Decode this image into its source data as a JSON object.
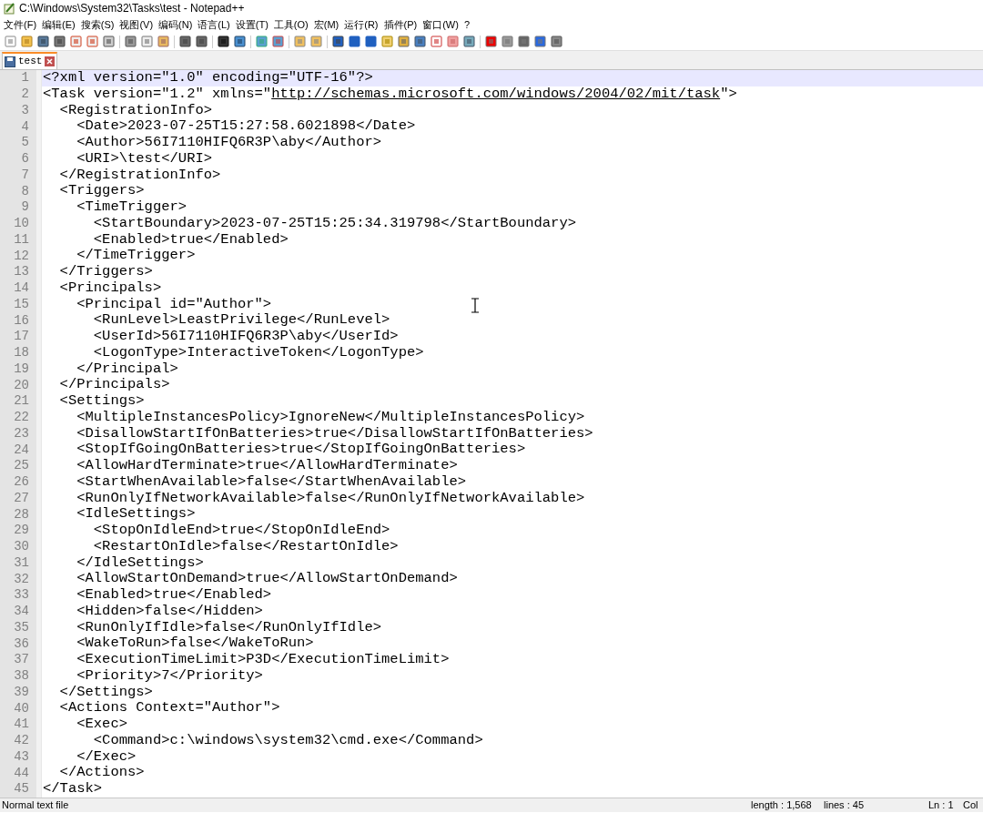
{
  "window": {
    "title": "C:\\Windows\\System32\\Tasks\\test - Notepad++"
  },
  "menu": [
    "文件(F)",
    "编辑(E)",
    "搜索(S)",
    "视图(V)",
    "编码(N)",
    "语言(L)",
    "设置(T)",
    "工具(O)",
    "宏(M)",
    "运行(R)",
    "插件(P)",
    "窗口(W)",
    "?"
  ],
  "tabs": [
    {
      "label": "test",
      "selected": true
    }
  ],
  "editor": {
    "lines": [
      {
        "number": "1",
        "current": true,
        "text": "<?xml version=\"1.0\" encoding=\"UTF-16\"?>"
      },
      {
        "number": "2",
        "current": false,
        "parts": [
          {
            "text": "<Task version=\"1.2\" xmlns=\""
          },
          {
            "text": "http://schemas.microsoft.com/windows/2004/02/mit/task",
            "kind": "link"
          },
          {
            "text": "\">"
          }
        ]
      },
      {
        "number": "3",
        "current": false,
        "text": "  <RegistrationInfo>"
      },
      {
        "number": "4",
        "current": false,
        "text": "    <Date>2023-07-25T15:27:58.6021898</Date>"
      },
      {
        "number": "5",
        "current": false,
        "text": "    <Author>56I7110HIFQ6R3P\\aby</Author>"
      },
      {
        "number": "6",
        "current": false,
        "text": "    <URI>\\test</URI>"
      },
      {
        "number": "7",
        "current": false,
        "text": "  </RegistrationInfo>"
      },
      {
        "number": "8",
        "current": false,
        "text": "  <Triggers>"
      },
      {
        "number": "9",
        "current": false,
        "text": "    <TimeTrigger>"
      },
      {
        "number": "10",
        "current": false,
        "text": "      <StartBoundary>2023-07-25T15:25:34.319798</StartBoundary>"
      },
      {
        "number": "11",
        "current": false,
        "text": "      <Enabled>true</Enabled>"
      },
      {
        "number": "12",
        "current": false,
        "text": "    </TimeTrigger>"
      },
      {
        "number": "13",
        "current": false,
        "text": "  </Triggers>"
      },
      {
        "number": "14",
        "current": false,
        "text": "  <Principals>"
      },
      {
        "number": "15",
        "current": false,
        "text": "    <Principal id=\"Author\">"
      },
      {
        "number": "16",
        "current": false,
        "text": "      <RunLevel>LeastPrivilege</RunLevel>"
      },
      {
        "number": "17",
        "current": false,
        "text": "      <UserId>56I7110HIFQ6R3P\\aby</UserId>"
      },
      {
        "number": "18",
        "current": false,
        "text": "      <LogonType>InteractiveToken</LogonType>"
      },
      {
        "number": "19",
        "current": false,
        "text": "    </Principal>"
      },
      {
        "number": "20",
        "current": false,
        "text": "  </Principals>"
      },
      {
        "number": "21",
        "current": false,
        "text": "  <Settings>"
      },
      {
        "number": "22",
        "current": false,
        "text": "    <MultipleInstancesPolicy>IgnoreNew</MultipleInstancesPolicy>"
      },
      {
        "number": "23",
        "current": false,
        "text": "    <DisallowStartIfOnBatteries>true</DisallowStartIfOnBatteries>"
      },
      {
        "number": "24",
        "current": false,
        "text": "    <StopIfGoingOnBatteries>true</StopIfGoingOnBatteries>"
      },
      {
        "number": "25",
        "current": false,
        "text": "    <AllowHardTerminate>true</AllowHardTerminate>"
      },
      {
        "number": "26",
        "current": false,
        "text": "    <StartWhenAvailable>false</StartWhenAvailable>"
      },
      {
        "number": "27",
        "current": false,
        "text": "    <RunOnlyIfNetworkAvailable>false</RunOnlyIfNetworkAvailable>"
      },
      {
        "number": "28",
        "current": false,
        "text": "    <IdleSettings>"
      },
      {
        "number": "29",
        "current": false,
        "text": "      <StopOnIdleEnd>true</StopOnIdleEnd>"
      },
      {
        "number": "30",
        "current": false,
        "text": "      <RestartOnIdle>false</RestartOnIdle>"
      },
      {
        "number": "31",
        "current": false,
        "text": "    </IdleSettings>"
      },
      {
        "number": "32",
        "current": false,
        "text": "    <AllowStartOnDemand>true</AllowStartOnDemand>"
      },
      {
        "number": "33",
        "current": false,
        "text": "    <Enabled>true</Enabled>"
      },
      {
        "number": "34",
        "current": false,
        "text": "    <Hidden>false</Hidden>"
      },
      {
        "number": "35",
        "current": false,
        "text": "    <RunOnlyIfIdle>false</RunOnlyIfIdle>"
      },
      {
        "number": "36",
        "current": false,
        "text": "    <WakeToRun>false</WakeToRun>"
      },
      {
        "number": "37",
        "current": false,
        "text": "    <ExecutionTimeLimit>P3D</ExecutionTimeLimit>"
      },
      {
        "number": "38",
        "current": false,
        "text": "    <Priority>7</Priority>"
      },
      {
        "number": "39",
        "current": false,
        "text": "  </Settings>"
      },
      {
        "number": "40",
        "current": false,
        "text": "  <Actions Context=\"Author\">"
      },
      {
        "number": "41",
        "current": false,
        "text": "    <Exec>"
      },
      {
        "number": "42",
        "current": false,
        "text": "      <Command>c:\\windows\\system32\\cmd.exe</Command>"
      },
      {
        "number": "43",
        "current": false,
        "text": "    </Exec>"
      },
      {
        "number": "44",
        "current": false,
        "text": "  </Actions>"
      },
      {
        "number": "45",
        "current": false,
        "text": "</Task>"
      }
    ]
  },
  "status_bar": {
    "file_type": "Normal text file",
    "length": "length : 1,568",
    "lines": "lines : 45",
    "position": "Ln : 1",
    "column": "Col"
  }
}
